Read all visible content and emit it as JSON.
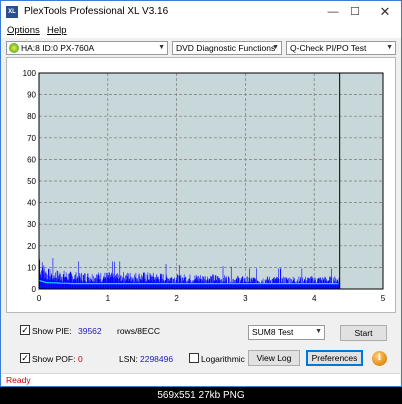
{
  "window": {
    "title": "PlexTools Professional XL V3.16",
    "app_icon_text": "XL",
    "minimize_glyph": "—",
    "maximize_glyph": "☐",
    "close_glyph": "✕"
  },
  "menu": {
    "options": "Options",
    "help": "Help"
  },
  "toolbar": {
    "drive": "HA:8 ID:0  PX-760A",
    "function": "DVD Diagnostic Functions",
    "test": "Q-Check PI/PO Test"
  },
  "colors": {
    "pie_bars": "#0000ff",
    "pif_line": "#00e0ff",
    "chart_bg": "#c8d7d9",
    "grid_dash": "#7a7a7a"
  },
  "chart_data": {
    "type": "bar",
    "x_range": [
      0,
      5
    ],
    "y_range": [
      0,
      100
    ],
    "x_ticks": [
      "0",
      "1",
      "2",
      "3",
      "4",
      "5"
    ],
    "y_ticks": [
      "0",
      "10",
      "20",
      "30",
      "40",
      "50",
      "60",
      "70",
      "80",
      "90",
      "100"
    ],
    "data_end_x": 4.37,
    "grid": true,
    "series": [
      {
        "kind": "pie-sum8",
        "profile": [
          [
            0.0,
            22
          ],
          [
            0.02,
            12
          ],
          [
            0.05,
            14
          ],
          [
            0.1,
            10
          ],
          [
            0.2,
            9
          ],
          [
            0.3,
            9
          ],
          [
            0.5,
            8
          ],
          [
            0.8,
            8
          ],
          [
            1.0,
            8
          ],
          [
            1.5,
            8
          ],
          [
            2.0,
            7
          ],
          [
            2.5,
            7
          ],
          [
            3.0,
            6
          ],
          [
            3.5,
            6
          ],
          [
            4.0,
            6
          ],
          [
            4.37,
            6
          ]
        ]
      },
      {
        "kind": "pif-line",
        "profile": [
          [
            0.0,
            4
          ],
          [
            0.1,
            3
          ],
          [
            0.5,
            2.5
          ],
          [
            1.0,
            2.5
          ],
          [
            2.0,
            2.5
          ],
          [
            3.0,
            2.5
          ],
          [
            4.37,
            2.5
          ]
        ]
      }
    ]
  },
  "controls": {
    "show_pie_label": "Show PIE:",
    "pie_value": "39562",
    "pie_unit": "rows/8ECC",
    "show_pof_label": "Show POF:",
    "pof_value": "0",
    "lsn_label": "LSN:",
    "lsn_value": "2298496",
    "logarithmic_label": "Logarithmic",
    "mode_select": "SUM8 Test",
    "start_button": "Start",
    "viewlog_button": "View Log",
    "preferences_button": "Preferences",
    "info_glyph": "i",
    "check_glyph": "✓"
  },
  "status": {
    "text": "Ready"
  },
  "caption": {
    "text": "569x551  27kb  PNG"
  }
}
